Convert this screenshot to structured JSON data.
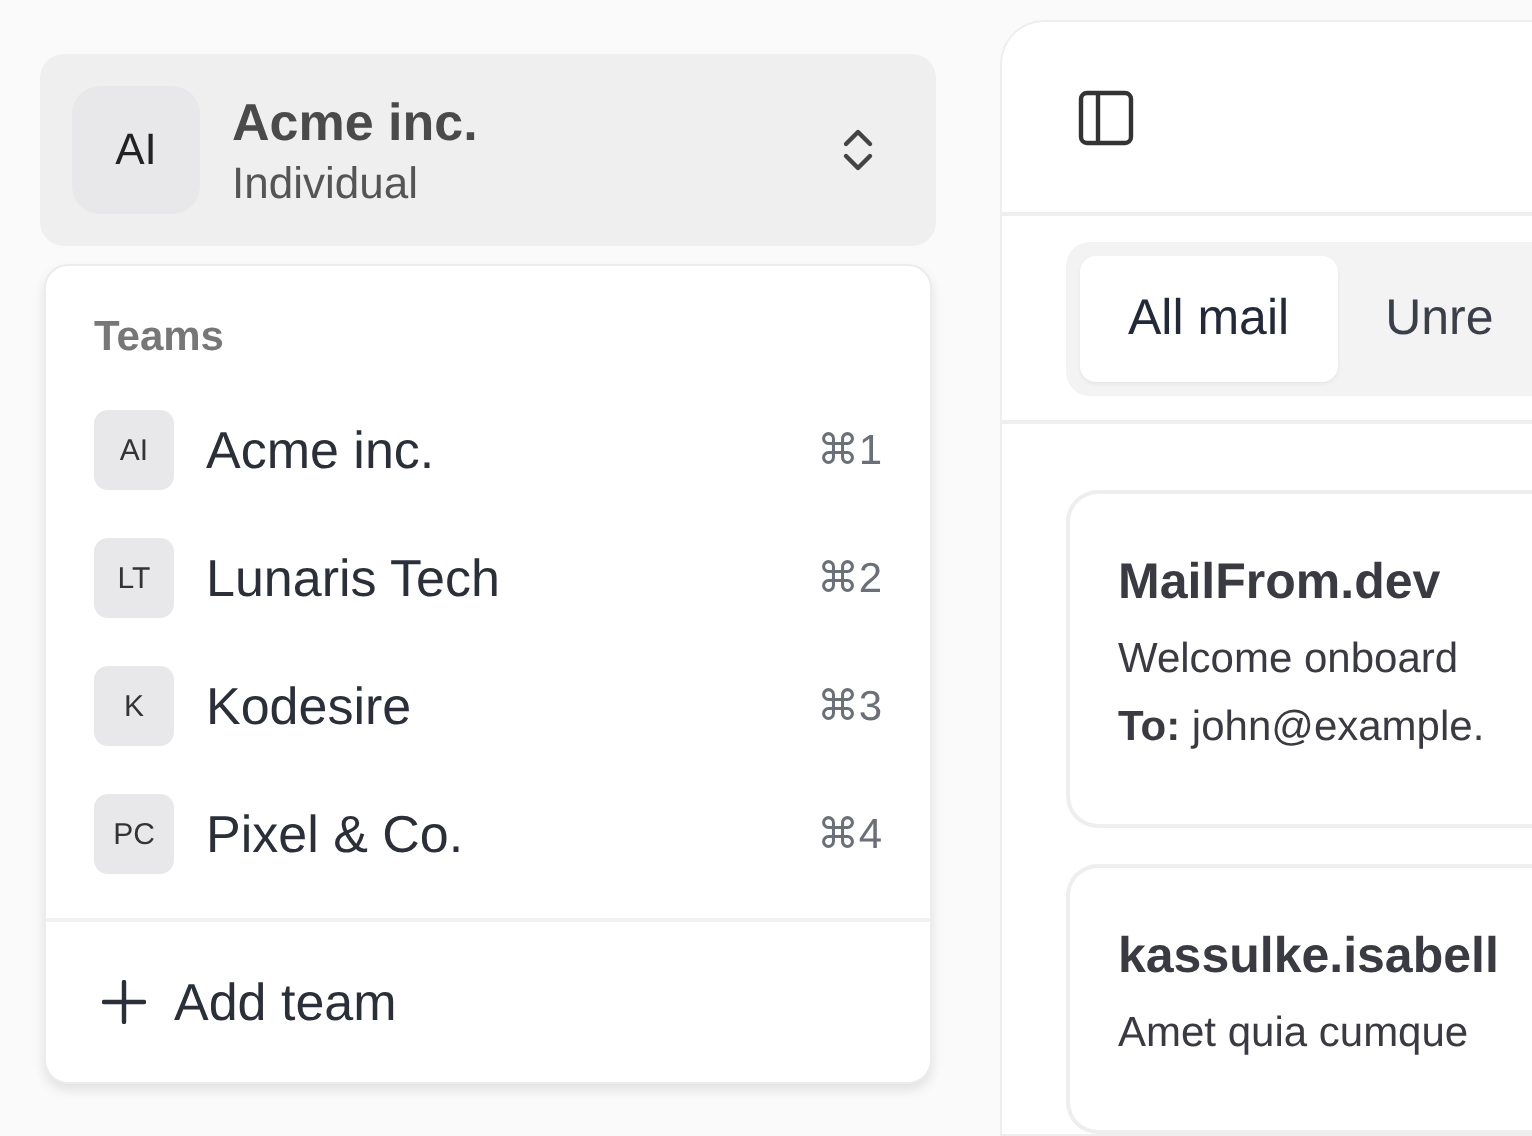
{
  "team_switcher": {
    "initials": "AI",
    "name": "Acme inc.",
    "plan": "Individual"
  },
  "teams_menu": {
    "heading": "Teams",
    "teams": [
      {
        "initials": "AI",
        "name": "Acme inc.",
        "shortcut": "⌘1"
      },
      {
        "initials": "LT",
        "name": "Lunaris Tech",
        "shortcut": "⌘2"
      },
      {
        "initials": "K",
        "name": "Kodesire",
        "shortcut": "⌘3"
      },
      {
        "initials": "PC",
        "name": "Pixel & Co.",
        "shortcut": "⌘4"
      }
    ],
    "add_label": "Add team"
  },
  "tabs": [
    {
      "label": "All mail",
      "selected": true
    },
    {
      "label": "Unre",
      "selected": false
    }
  ],
  "mails": [
    {
      "sender": "MailFrom.dev",
      "subject": "Welcome onboard",
      "to": "**To:** john@example."
    },
    {
      "sender": "kassulke.isabell",
      "subject": "Amet quia cumque"
    }
  ]
}
